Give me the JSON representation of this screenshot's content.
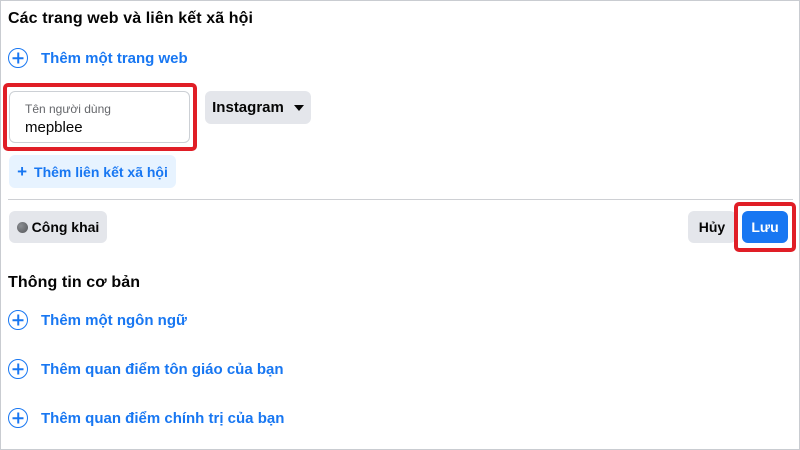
{
  "websites_section": {
    "title": "Các trang web và liên kết xã hội",
    "add_website_label": "Thêm một trang web",
    "username_field": {
      "label": "Tên người dùng",
      "value": "mepblee"
    },
    "platform_dropdown": {
      "selected": "Instagram"
    },
    "add_social_link": {
      "icon": "+",
      "label": "Thêm liên kết xã hội"
    }
  },
  "actions": {
    "privacy_label": "Công khai",
    "cancel_label": "Hủy",
    "save_label": "Lưu"
  },
  "basic_info_section": {
    "title": "Thông tin cơ bản",
    "items": [
      {
        "label": "Thêm một ngôn ngữ"
      },
      {
        "label": "Thêm quan điểm tôn giáo của bạn"
      },
      {
        "label": "Thêm quan điểm chính trị của bạn"
      }
    ]
  },
  "colors": {
    "accent_blue": "#1877f2",
    "light_blue_bg": "#e7f3ff",
    "gray_button": "#e4e6eb",
    "highlight_red": "#e01e26"
  },
  "icons": {
    "add": "plus-circle-icon",
    "privacy": "globe-icon",
    "dropdown": "caret-down-icon"
  }
}
